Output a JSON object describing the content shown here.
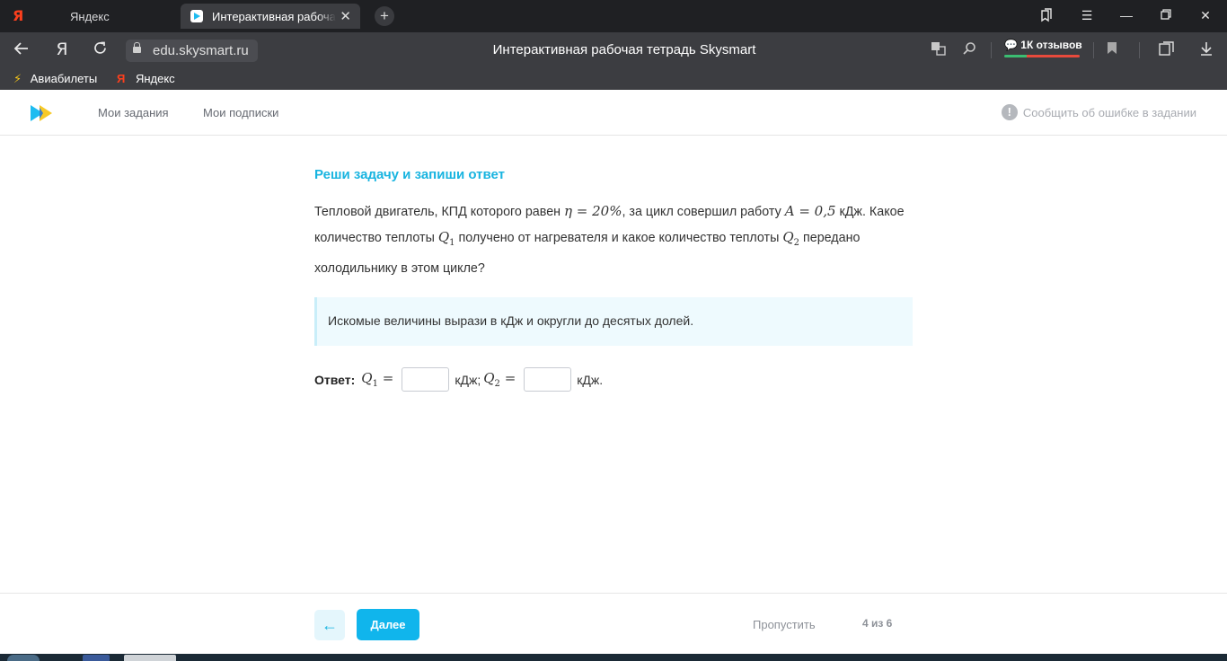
{
  "browser": {
    "tabs": [
      {
        "label": "Яндекс",
        "icon": "yandex-icon"
      },
      {
        "label": "Интерактивная рабоча",
        "icon": "skysmart-favicon-icon",
        "active": true
      }
    ],
    "url": "edu.skysmart.ru",
    "page_title": "Интерактивная рабочая тетрадь Skysmart",
    "reviews_label": "1К отзывов",
    "bookmarks": [
      {
        "label": "Авиабилеты",
        "icon": "plane-icon"
      },
      {
        "label": "Яндекс",
        "icon": "yandex-icon"
      }
    ]
  },
  "site": {
    "nav": [
      "Мои задания",
      "Мои подписки"
    ],
    "report_label": "Сообщить об ошибке в задании",
    "report_icon_glyph": "!"
  },
  "task": {
    "heading": "Реши задачу и запиши ответ",
    "text_1": "Тепловой двигатель, КПД которого равен ",
    "eta_formula": "η = 20%",
    "text_2": ", за цикл совершил работу ",
    "work_formula": "A = 0,5",
    "text_3": " кДж. Какое количество теплоты ",
    "q1_symbol": "Q",
    "q1_index": "1",
    "text_4": " получено от нагревателя и какое количество теплоты ",
    "q2_symbol": "Q",
    "q2_index": "2",
    "text_5": " передано холодильнику в этом цикле?",
    "hint": "Искомые величины вырази в кДж и округли до десятых долей.",
    "answer_label": "Ответ:",
    "answer_q1_symbol": "Q",
    "answer_q1_index": "1",
    "answer_eq": "=",
    "answer_q1_value": "",
    "answer_unit_1": "кДж;",
    "answer_q2_symbol": "Q",
    "answer_q2_index": "2",
    "answer_q2_value": "",
    "answer_unit_2": "кДж."
  },
  "footer": {
    "back_glyph": "←",
    "next_label": "Далее",
    "skip_label": "Пропустить",
    "counter": "4 из 6"
  },
  "colors": {
    "accent": "#10b5ec",
    "heading": "#18b4e0",
    "hint_bg": "#eefafe"
  }
}
